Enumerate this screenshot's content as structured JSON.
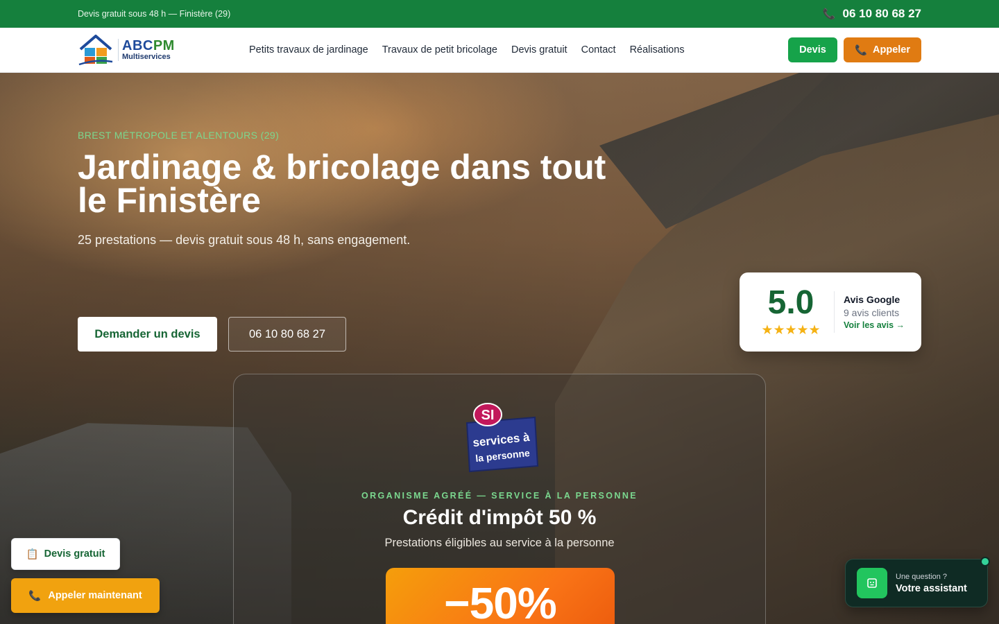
{
  "topbar": {
    "tagline": "Devis gratuit sous 48 h — Finistère (29)",
    "phone": "06 10 80 68 27",
    "phone_icon": "phone-icon"
  },
  "header": {
    "logo": {
      "brand_part1": "ABC",
      "brand_part2": "PM",
      "sub": "Multiservices"
    },
    "nav": [
      "Petits travaux de jardinage",
      "Travaux de petit bricolage",
      "Devis gratuit",
      "Contact",
      "Réalisations"
    ],
    "devis_label": "Devis",
    "appeler_label": "Appeler"
  },
  "hero": {
    "eyebrow": "BREST MÉTROPOLE ET ALENTOURS (29)",
    "title": "Jardinage & bricolage dans tout le Finistère",
    "subtitle": "25 prestations — devis gratuit sous 48 h, sans engagement.",
    "cta_primary": "Demander un devis",
    "cta_phone": "06 10 80 68 27"
  },
  "rating": {
    "score": "5.0",
    "stars": "★★★★★",
    "title": "Avis Google",
    "count": "9 avis clients",
    "link": "Voir les avis →",
    "star_color": "#f5b214"
  },
  "sap": {
    "logo_text1": "SI",
    "logo_text2": "services à",
    "logo_text3": "la personne",
    "eyebrow": "ORGANISME AGRÉÉ — SERVICE À LA PERSONNE",
    "title": "Crédit d'impôt 50 %",
    "subtitle": "Prestations éligibles au service à la personne",
    "badge": "−50%"
  },
  "floating": {
    "devis": "Devis gratuit",
    "call": "Appeler maintenant"
  },
  "assistant": {
    "question": "Une question ?",
    "name": "Votre assistant"
  },
  "colors": {
    "primary_green": "#15803d",
    "accent_orange": "#e07b12",
    "light_green": "#7bd88f"
  }
}
